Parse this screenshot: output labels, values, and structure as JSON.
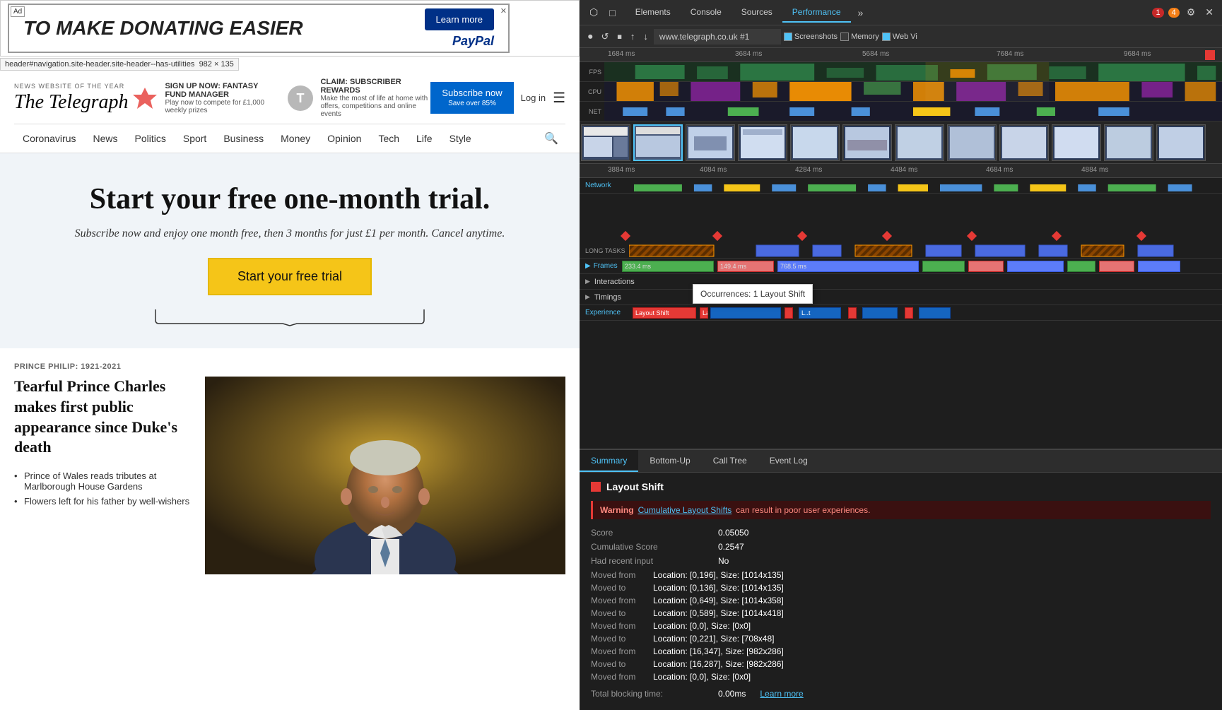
{
  "website": {
    "ad": {
      "text": "TO MAKE DONATING EASIER",
      "learn_btn": "Learn more",
      "paypal": "PayPal",
      "close": "✕",
      "ad_marker": "Ad"
    },
    "tooltip": "header#navigation.site-header.site-header--has-utilities",
    "tooltip_size": "982 × 135",
    "header": {
      "news_of_year": "NEWS WEBSITE OF THE YEAR",
      "logo": "The Telegraph",
      "promo1_title": "SIGN UP NOW: FANTASY FUND MANAGER",
      "promo1_desc": "Play now to compete for £1,000 weekly prizes",
      "promo2_title": "CLAIM: SUBSCRIBER REWARDS",
      "promo2_desc": "Make the most of life at home with offers, competitions and online events",
      "subscribe_btn": "Subscribe now",
      "subscribe_sub": "Save over 85%",
      "login_btn": "Log in"
    },
    "nav": {
      "items": [
        "Coronavirus",
        "News",
        "Politics",
        "Sport",
        "Business",
        "Money",
        "Opinion",
        "Tech",
        "Life",
        "Style"
      ]
    },
    "subscription": {
      "heading": "Start your free one-month trial.",
      "subtext": "Subscribe now and enjoy one month free, then 3 months for just £1 per month. Cancel anytime.",
      "cta_btn": "Start your free trial"
    },
    "article": {
      "tag": "PRINCE PHILIP: 1921-2021",
      "headline": "Tearful Prince Charles makes first public appearance since Duke's death",
      "bullets": [
        "Prince of Wales reads tributes at Marlborough House Gardens",
        "Flowers left for his father by well-wishers"
      ]
    }
  },
  "devtools": {
    "tabs": [
      "Elements",
      "Console",
      "Sources",
      "Performance"
    ],
    "active_tab": "Performance",
    "icons": {
      "cursor": "⬡",
      "inspect": "□",
      "device": "📱",
      "reload": "↺",
      "stop": "✕",
      "capture": "⏺",
      "import": "↑",
      "export": "↓"
    },
    "url": "www.telegraph.co.uk #1",
    "checkboxes": {
      "screenshots": "Screenshots",
      "memory": "Memory",
      "webvi": "Web Vi"
    },
    "alerts": {
      "red": "1",
      "yellow": "4"
    },
    "timeline": {
      "time_marks_top": [
        "1684 ms",
        "3684 ms",
        "5684 ms",
        "7684 ms",
        "9684 ms"
      ],
      "time_marks_bottom": [
        "3884 ms",
        "4084 ms",
        "4284 ms",
        "4484 ms",
        "4684 ms",
        "4884 ms"
      ],
      "rows": {
        "fps_label": "FPS",
        "cpu_label": "CPU",
        "net_label": "NET"
      },
      "network_label": "Network",
      "long_tasks_label": "LONG TASKS",
      "frames_label": "Frames",
      "frames_data": [
        "233.4 ms",
        "149.4 ms",
        "768.5 ms"
      ],
      "interactions_label": "Interactions",
      "timings_label": "Timings",
      "experience_label": "Experience"
    },
    "tooltip_popup": {
      "text": "Occurrences: 1  Layout Shift"
    },
    "summary": {
      "tabs": [
        "Summary",
        "Bottom-Up",
        "Call Tree",
        "Event Log"
      ],
      "active_tab": "Summary",
      "title": "Layout Shift",
      "warning_label": "Warning",
      "warning_link": "Cumulative Layout Shifts",
      "warning_text": "can result in poor user experiences.",
      "score_label": "Score",
      "score_val": "0.05050",
      "cumulative_label": "Cumulative Score",
      "cumulative_val": "0.2547",
      "recent_input_label": "Had recent input",
      "recent_input_val": "No",
      "moved_from_1_label": "Moved from",
      "moved_from_1_val": "Location: [0,196], Size: [1014x135]",
      "moved_to_1_label": "Moved to",
      "moved_to_1_val": "Location: [0,136], Size: [1014x135]",
      "moved_from_2_label": "Moved from",
      "moved_from_2_val": "Location: [0,649], Size: [1014x358]",
      "moved_to_2_label": "Moved to",
      "moved_to_2_val": "Location: [0,589], Size: [1014x418]",
      "moved_from_3_label": "Moved from",
      "moved_from_3_val": "Location: [0,0], Size: [0x0]",
      "moved_to_3_label": "Moved to",
      "moved_to_3_val": "Location: [0,221], Size: [708x48]",
      "moved_from_4_label": "Moved from",
      "moved_from_4_val": "Location: [16,347], Size: [982x286]",
      "moved_to_4_label": "Moved to",
      "moved_to_4_val": "Location: [16,287], Size: [982x286]",
      "moved_from_5_label": "Moved from",
      "moved_from_5_val": "Location: [0,0], Size: [0x0]",
      "total_blocking_label": "Total blocking time:",
      "total_blocking_val": "0.00ms",
      "learn_more": "Learn more"
    }
  }
}
